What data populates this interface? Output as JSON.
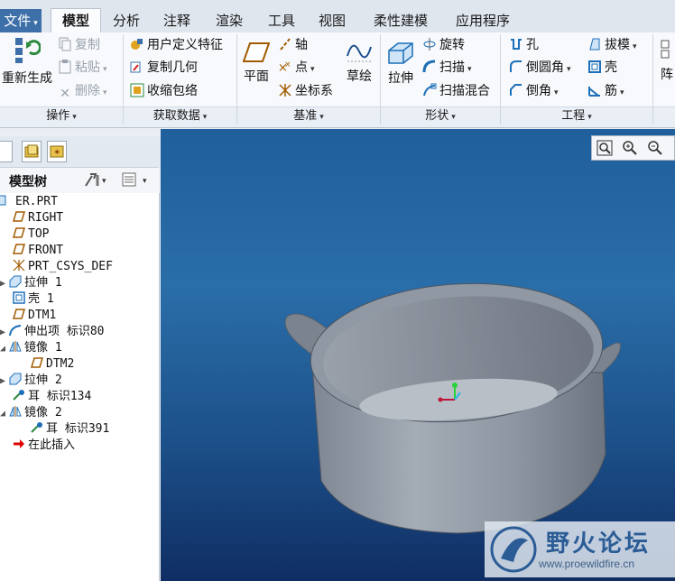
{
  "tabs": [
    {
      "label": "文件",
      "active": false
    },
    {
      "label": "模型",
      "active": true
    },
    {
      "label": "分析",
      "active": false
    },
    {
      "label": "注释",
      "active": false
    },
    {
      "label": "渲染",
      "active": false
    },
    {
      "label": "工具",
      "active": false
    },
    {
      "label": "视图",
      "active": false
    },
    {
      "label": "柔性建模",
      "active": false
    },
    {
      "label": "应用程序",
      "active": false
    }
  ],
  "ribbon": {
    "operations": {
      "regenerate": "重新生成",
      "copy": "复制",
      "paste": "粘贴",
      "delete": "删除",
      "label": "操作"
    },
    "get_data": {
      "udf": "用户定义特征",
      "copy_geom": "复制几何",
      "shrinkwrap": "收缩包络",
      "label": "获取数据"
    },
    "datum": {
      "plane": "平面",
      "axis": "轴",
      "point": "点",
      "csys": "坐标系",
      "sketch": "草绘",
      "label": "基准"
    },
    "shapes": {
      "extrude": "拉伸",
      "revolve": "旋转",
      "sweep": "扫描",
      "swept_blend": "扫描混合",
      "label": "形状"
    },
    "engineering": {
      "hole": "孔",
      "round": "倒圆角",
      "chamfer": "倒角",
      "draft": "拔模",
      "shell": "壳",
      "rib": "筋",
      "pattern": "阵",
      "label": "工程"
    }
  },
  "tree": {
    "title": "模型树",
    "items": [
      {
        "label": "ER.PRT",
        "icon": "part-icon",
        "expand": ""
      },
      {
        "label": "RIGHT",
        "icon": "datum-plane-icon",
        "expand": ""
      },
      {
        "label": "TOP",
        "icon": "datum-plane-icon",
        "expand": ""
      },
      {
        "label": "FRONT",
        "icon": "datum-plane-icon",
        "expand": ""
      },
      {
        "label": "PRT_CSYS_DEF",
        "icon": "csys-icon",
        "expand": ""
      },
      {
        "label": "拉伸 1",
        "icon": "extrude-icon",
        "expand": "▶"
      },
      {
        "label": "壳 1",
        "icon": "shell-icon",
        "expand": ""
      },
      {
        "label": "DTM1",
        "icon": "datum-plane-icon",
        "expand": ""
      },
      {
        "label": "伸出项 标识80",
        "icon": "protrusion-icon",
        "expand": "▶"
      },
      {
        "label": "镜像 1",
        "icon": "mirror-icon",
        "expand": "◢"
      },
      {
        "label": "DTM2",
        "icon": "datum-plane-icon",
        "expand": ""
      },
      {
        "label": "拉伸 2",
        "icon": "extrude-icon",
        "expand": "▶"
      },
      {
        "label": "耳 标识134",
        "icon": "ear-icon",
        "expand": ""
      },
      {
        "label": "镜像 2",
        "icon": "mirror-icon",
        "expand": "◢"
      },
      {
        "label": "耳 标识391",
        "icon": "ear-icon",
        "expand": ""
      },
      {
        "label": "在此插入",
        "icon": "insert-arrow-icon",
        "expand": ""
      }
    ]
  },
  "watermark": {
    "title": "野火论坛",
    "url": "www.proewildfire.cn"
  },
  "colors": {
    "accent": "#3d6fa8",
    "viewport_top": "#1f5f9c",
    "viewport_bottom": "#0f2e63",
    "model": "#8a93a0"
  }
}
